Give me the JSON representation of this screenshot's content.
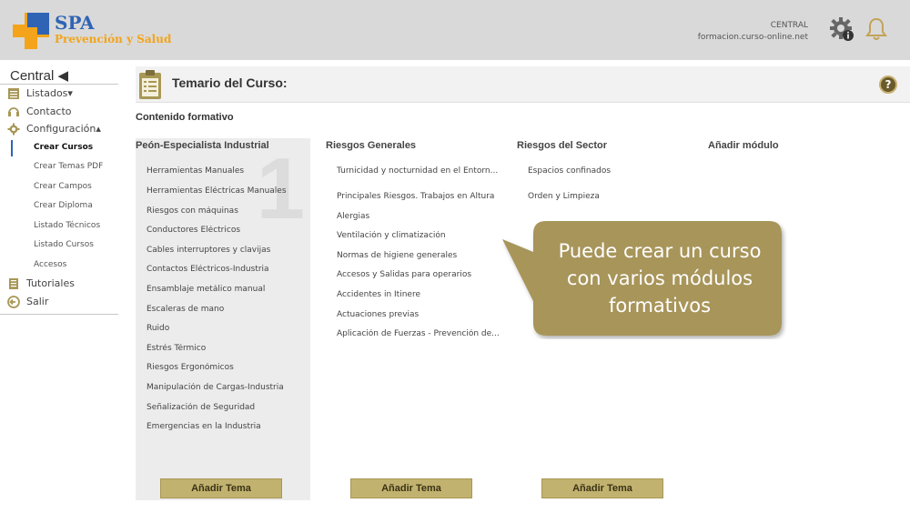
{
  "header": {
    "logo_title": "SPA",
    "logo_subtitle": "Prevención y Salud",
    "account_name": "CENTRAL",
    "account_domain": "formacion.curso-online.net",
    "icons": [
      "settings-info-icon",
      "bell-icon"
    ]
  },
  "sidebar": {
    "title": "Central ◀",
    "items": [
      {
        "label": "Listados▾",
        "icon": "list-icon"
      },
      {
        "label": "Contacto",
        "icon": "headset-icon"
      },
      {
        "label": "Configuración▴",
        "icon": "gear-icon"
      }
    ],
    "subitems": [
      {
        "label": "Crear Cursos",
        "active": true
      },
      {
        "label": "Crear Temas PDF"
      },
      {
        "label": "Crear Campos"
      },
      {
        "label": "Crear Diploma"
      },
      {
        "label": "Listado Técnicos"
      },
      {
        "label": "Listado Cursos"
      },
      {
        "label": "Accesos"
      }
    ],
    "bottom_items": [
      {
        "label": "Tutoriales",
        "icon": "book-icon"
      },
      {
        "label": "Salir",
        "icon": "exit-icon"
      }
    ]
  },
  "main": {
    "title": "Temario del Curso:",
    "content_label": "Contenido formativo",
    "help": "?",
    "modules": [
      {
        "title": "Peón-Especialista Industrial",
        "number": "1",
        "topics": [
          "Herramientas Manuales",
          "Herramientas Eléctricas Manuales",
          "Riesgos con máquinas",
          "Conductores Eléctricos",
          "Cables interruptores y clavijas",
          "Contactos Eléctricos-Industria",
          "Ensamblaje metálico manual",
          "Escaleras de mano",
          "Ruido",
          "Estrés Térmico",
          "Riesgos Ergonómicos",
          "Manipulación de Cargas-Industria",
          "Señalización de Seguridad",
          "Emergencias en la Industria"
        ],
        "button": "Añadir Tema"
      },
      {
        "title": "Riesgos Generales",
        "topics": [
          "Turnicidad y nocturnidad en el Entorn...",
          "Principales Riesgos. Trabajos en Altura",
          "Alergias",
          "Ventilación y climatización",
          "Normas de higiene generales",
          "Accesos y Salidas para operarios",
          "Accidentes in Itinere",
          "Actuaciones previas",
          "Aplicación de Fuerzas - Prevención de..."
        ],
        "button": "Añadir Tema"
      },
      {
        "title": "Riesgos del Sector",
        "topics": [
          "Espacios confinados",
          "Orden y Limpieza"
        ],
        "button": "Añadir Tema"
      }
    ],
    "add_module": "Añadir módulo"
  },
  "callout": {
    "line1": "Puede crear un curso",
    "line2": "con varios módulos",
    "line3": "formativos"
  },
  "colors": {
    "accent_gold": "#c2b26f",
    "callout_bg": "#a8955a",
    "brand_blue": "#2f64b4",
    "brand_orange": "#f3a41a"
  }
}
